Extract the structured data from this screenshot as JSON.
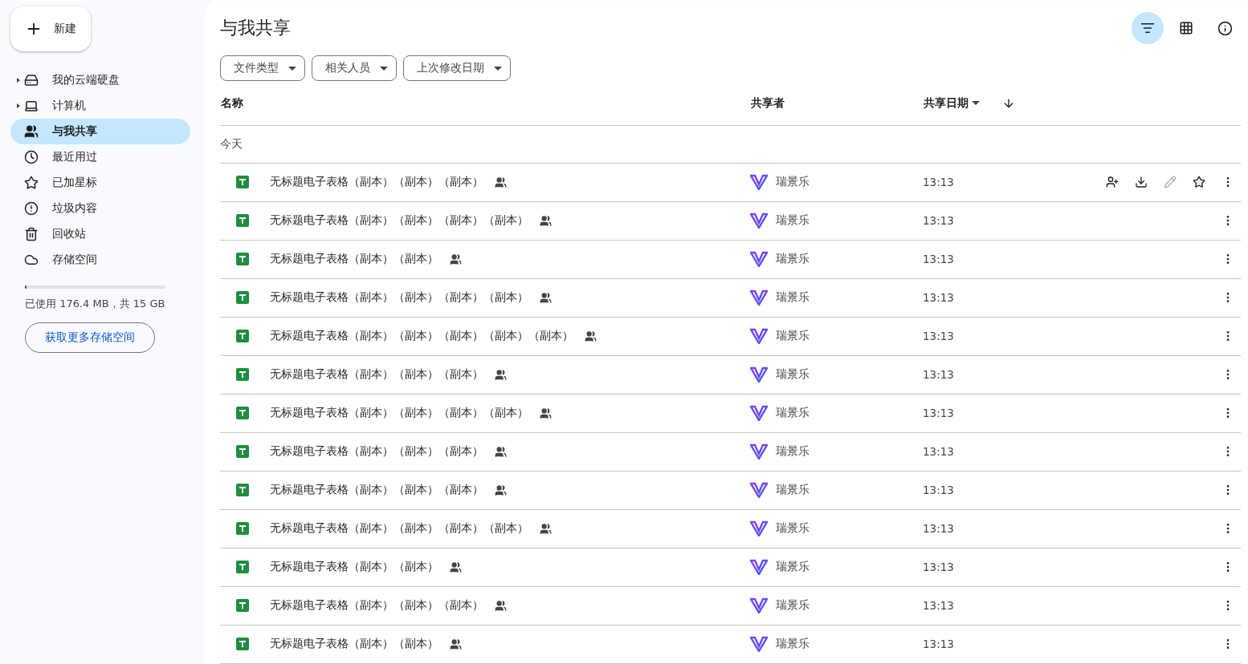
{
  "new_button": {
    "label": "新建"
  },
  "sidebar": {
    "items": [
      {
        "kind": "drive",
        "label": "我的云端硬盘",
        "expandable": true,
        "selected": false
      },
      {
        "kind": "computer",
        "label": "计算机",
        "expandable": true,
        "selected": false
      },
      {
        "kind": "shared",
        "label": "与我共享",
        "expandable": false,
        "selected": true
      },
      {
        "kind": "recent",
        "label": "最近用过",
        "expandable": false,
        "selected": false
      },
      {
        "kind": "starred",
        "label": "已加星标",
        "expandable": false,
        "selected": false
      },
      {
        "kind": "spam",
        "label": "垃圾内容",
        "expandable": false,
        "selected": false
      },
      {
        "kind": "trash",
        "label": "回收站",
        "expandable": false,
        "selected": false
      },
      {
        "kind": "storage",
        "label": "存储空间",
        "expandable": false,
        "selected": false
      }
    ],
    "storage": {
      "level": 0.012,
      "text": "已使用 176.4 MB，共 15 GB",
      "button": "获取更多存储空间"
    }
  },
  "page": {
    "title": "与我共享",
    "filter_active": true
  },
  "filters": [
    "文件类型",
    "相关人员",
    "上次修改日期"
  ],
  "table": {
    "columns": [
      {
        "label": "名称",
        "sortable": false
      },
      {
        "label": "共享者",
        "sortable": false
      },
      {
        "label": "共享日期",
        "sortable": true
      }
    ],
    "group": "今天",
    "rows": [
      {
        "name": "无标题电子表格（副本）（副本）（副本）",
        "sharer": "瑞景乐",
        "date": "13:13",
        "actions_shown": true
      },
      {
        "name": "无标题电子表格（副本）（副本）（副本）（副本）",
        "sharer": "瑞景乐",
        "date": "13:13",
        "actions_shown": false
      },
      {
        "name": "无标题电子表格（副本）（副本）",
        "sharer": "瑞景乐",
        "date": "13:13",
        "actions_shown": false
      },
      {
        "name": "无标题电子表格（副本）（副本）（副本）（副本）",
        "sharer": "瑞景乐",
        "date": "13:13",
        "actions_shown": false
      },
      {
        "name": "无标题电子表格（副本）（副本）（副本）（副本）（副本）",
        "sharer": "瑞景乐",
        "date": "13:13",
        "actions_shown": false
      },
      {
        "name": "无标题电子表格（副本）（副本）（副本）",
        "sharer": "瑞景乐",
        "date": "13:13",
        "actions_shown": false
      },
      {
        "name": "无标题电子表格（副本）（副本）（副本）（副本）",
        "sharer": "瑞景乐",
        "date": "13:13",
        "actions_shown": false
      },
      {
        "name": "无标题电子表格（副本）（副本）（副本）",
        "sharer": "瑞景乐",
        "date": "13:13",
        "actions_shown": false
      },
      {
        "name": "无标题电子表格（副本）（副本）（副本）",
        "sharer": "瑞景乐",
        "date": "13:13",
        "actions_shown": false
      },
      {
        "name": "无标题电子表格（副本）（副本）（副本）（副本）",
        "sharer": "瑞景乐",
        "date": "13:13",
        "actions_shown": false
      },
      {
        "name": "无标题电子表格（副本）（副本）",
        "sharer": "瑞景乐",
        "date": "13:13",
        "actions_shown": false
      },
      {
        "name": "无标题电子表格（副本）（副本）（副本）",
        "sharer": "瑞景乐",
        "date": "13:13",
        "actions_shown": false
      },
      {
        "name": "无标题电子表格（副本）（副本）",
        "sharer": "瑞景乐",
        "date": "13:13",
        "actions_shown": false
      }
    ]
  }
}
